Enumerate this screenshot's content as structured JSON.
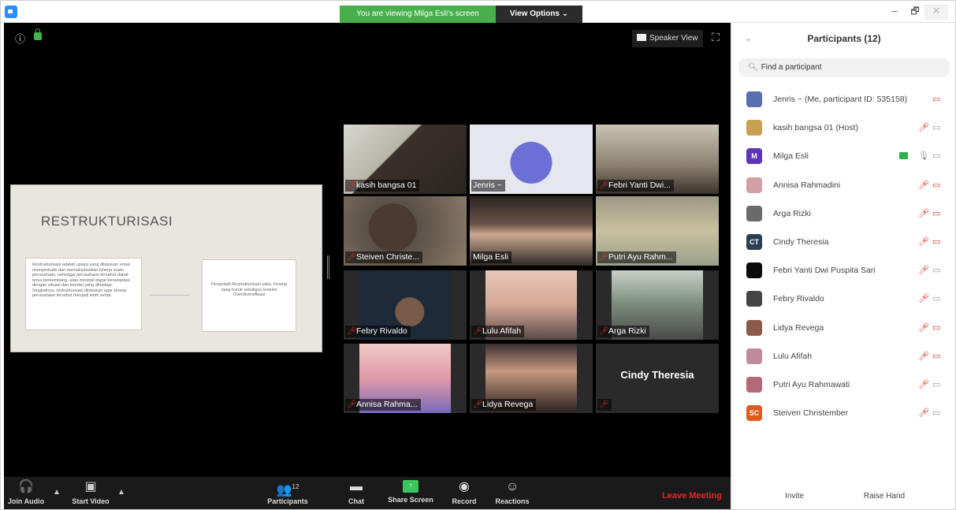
{
  "titlebar": {
    "viewing_banner": "You are viewing Milga Esli's screen",
    "view_options": "View Options ⌄",
    "minimize": "–",
    "maximize": "🗗",
    "close": "✕"
  },
  "video": {
    "speaker_view": "Speaker View",
    "slide": {
      "title": "RESTRUKTURISASI",
      "left_text": "Restrukturisasi adalah upaya yang dilakukan untuk memperbaiki dan memaksimalkan kinerja suatu perusahaan, sehingga perusahaan tersebut dapat terus berkembang, atau minimal dapat beradaptasi dengan situasi dan kondisi yang dihadapi. Singkatnya, restrukturisasi dilakukan agar kinerja perusahaan tersebut menjadi lebih sehat.",
      "right_text": "Penyebab Restrukturisasi yaitu, Kinerja yang buruk sekaligus koreksi Overdiversifikasi"
    },
    "tiles": [
      {
        "name": "kasih bangsa 01",
        "muted": true
      },
      {
        "name": "Jenris ~",
        "muted": false
      },
      {
        "name": "Febri Yanti Dwi...",
        "muted": true
      },
      {
        "name": "Steiven Christe...",
        "muted": true
      },
      {
        "name": "Milga Esli",
        "muted": false,
        "active": true
      },
      {
        "name": "Putri Ayu Rahm...",
        "muted": true
      },
      {
        "name": "Febry Rivaldo",
        "muted": true
      },
      {
        "name": "Lulu Afifah",
        "muted": true
      },
      {
        "name": "Arga Rizki",
        "muted": true
      },
      {
        "name": "Annisa Rahma...",
        "muted": true
      },
      {
        "name": "Lidya Revega",
        "muted": true
      },
      {
        "name": "",
        "muted": true,
        "big_name": "Cindy Theresia"
      }
    ]
  },
  "toolbar": {
    "join_audio": "Join Audio",
    "start_video": "Start Video",
    "participants": "Participants",
    "participants_count": "12",
    "chat": "Chat",
    "share_screen": "Share Screen",
    "record": "Record",
    "reactions": "Reactions",
    "leave": "Leave Meeting"
  },
  "panel": {
    "title": "Participants (12)",
    "search_placeholder": "Find a participant",
    "invite": "Invite",
    "raise_hand": "Raise Hand",
    "participants": [
      {
        "name": "Jenris ~ (Me, participant ID: 535158)",
        "avatar_color": "#5a6fb0",
        "initials": "",
        "mic": "none",
        "cam": "off"
      },
      {
        "name": "kasih bangsa 01 (Host)",
        "avatar_color": "#c8a050",
        "initials": "",
        "mic": "muted",
        "cam": "on"
      },
      {
        "name": "Milga Esli",
        "avatar_color": "#5b35b5",
        "initials": "M",
        "mic": "on",
        "cam": "on",
        "sharing": true
      },
      {
        "name": "Annisa Rahmadini",
        "avatar_color": "#d4a0a6",
        "initials": "",
        "mic": "muted",
        "cam": "off"
      },
      {
        "name": "Arga Rizki",
        "avatar_color": "#6a6a6a",
        "initials": "",
        "mic": "muted",
        "cam": "off"
      },
      {
        "name": "Cindy Theresia",
        "avatar_color": "#2c3e50",
        "initials": "CT",
        "mic": "muted",
        "cam": "off"
      },
      {
        "name": "Febri Yanti Dwi Puspita Sari",
        "avatar_color": "#0b0b0b",
        "initials": "",
        "mic": "muted",
        "cam": "on"
      },
      {
        "name": "Febry Rivaldo",
        "avatar_color": "#444444",
        "initials": "",
        "mic": "muted",
        "cam": "on"
      },
      {
        "name": "Lidya Revega",
        "avatar_color": "#8a5a4a",
        "initials": "",
        "mic": "muted",
        "cam": "off"
      },
      {
        "name": "Lulu Afifah",
        "avatar_color": "#c08a9a",
        "initials": "",
        "mic": "muted",
        "cam": "off"
      },
      {
        "name": "Putri Ayu Rahmawati",
        "avatar_color": "#b06a7a",
        "initials": "",
        "mic": "muted",
        "cam": "on"
      },
      {
        "name": "Steiven Christember",
        "avatar_color": "#e05a1e",
        "initials": "SC",
        "mic": "muted",
        "cam": "on"
      }
    ]
  }
}
